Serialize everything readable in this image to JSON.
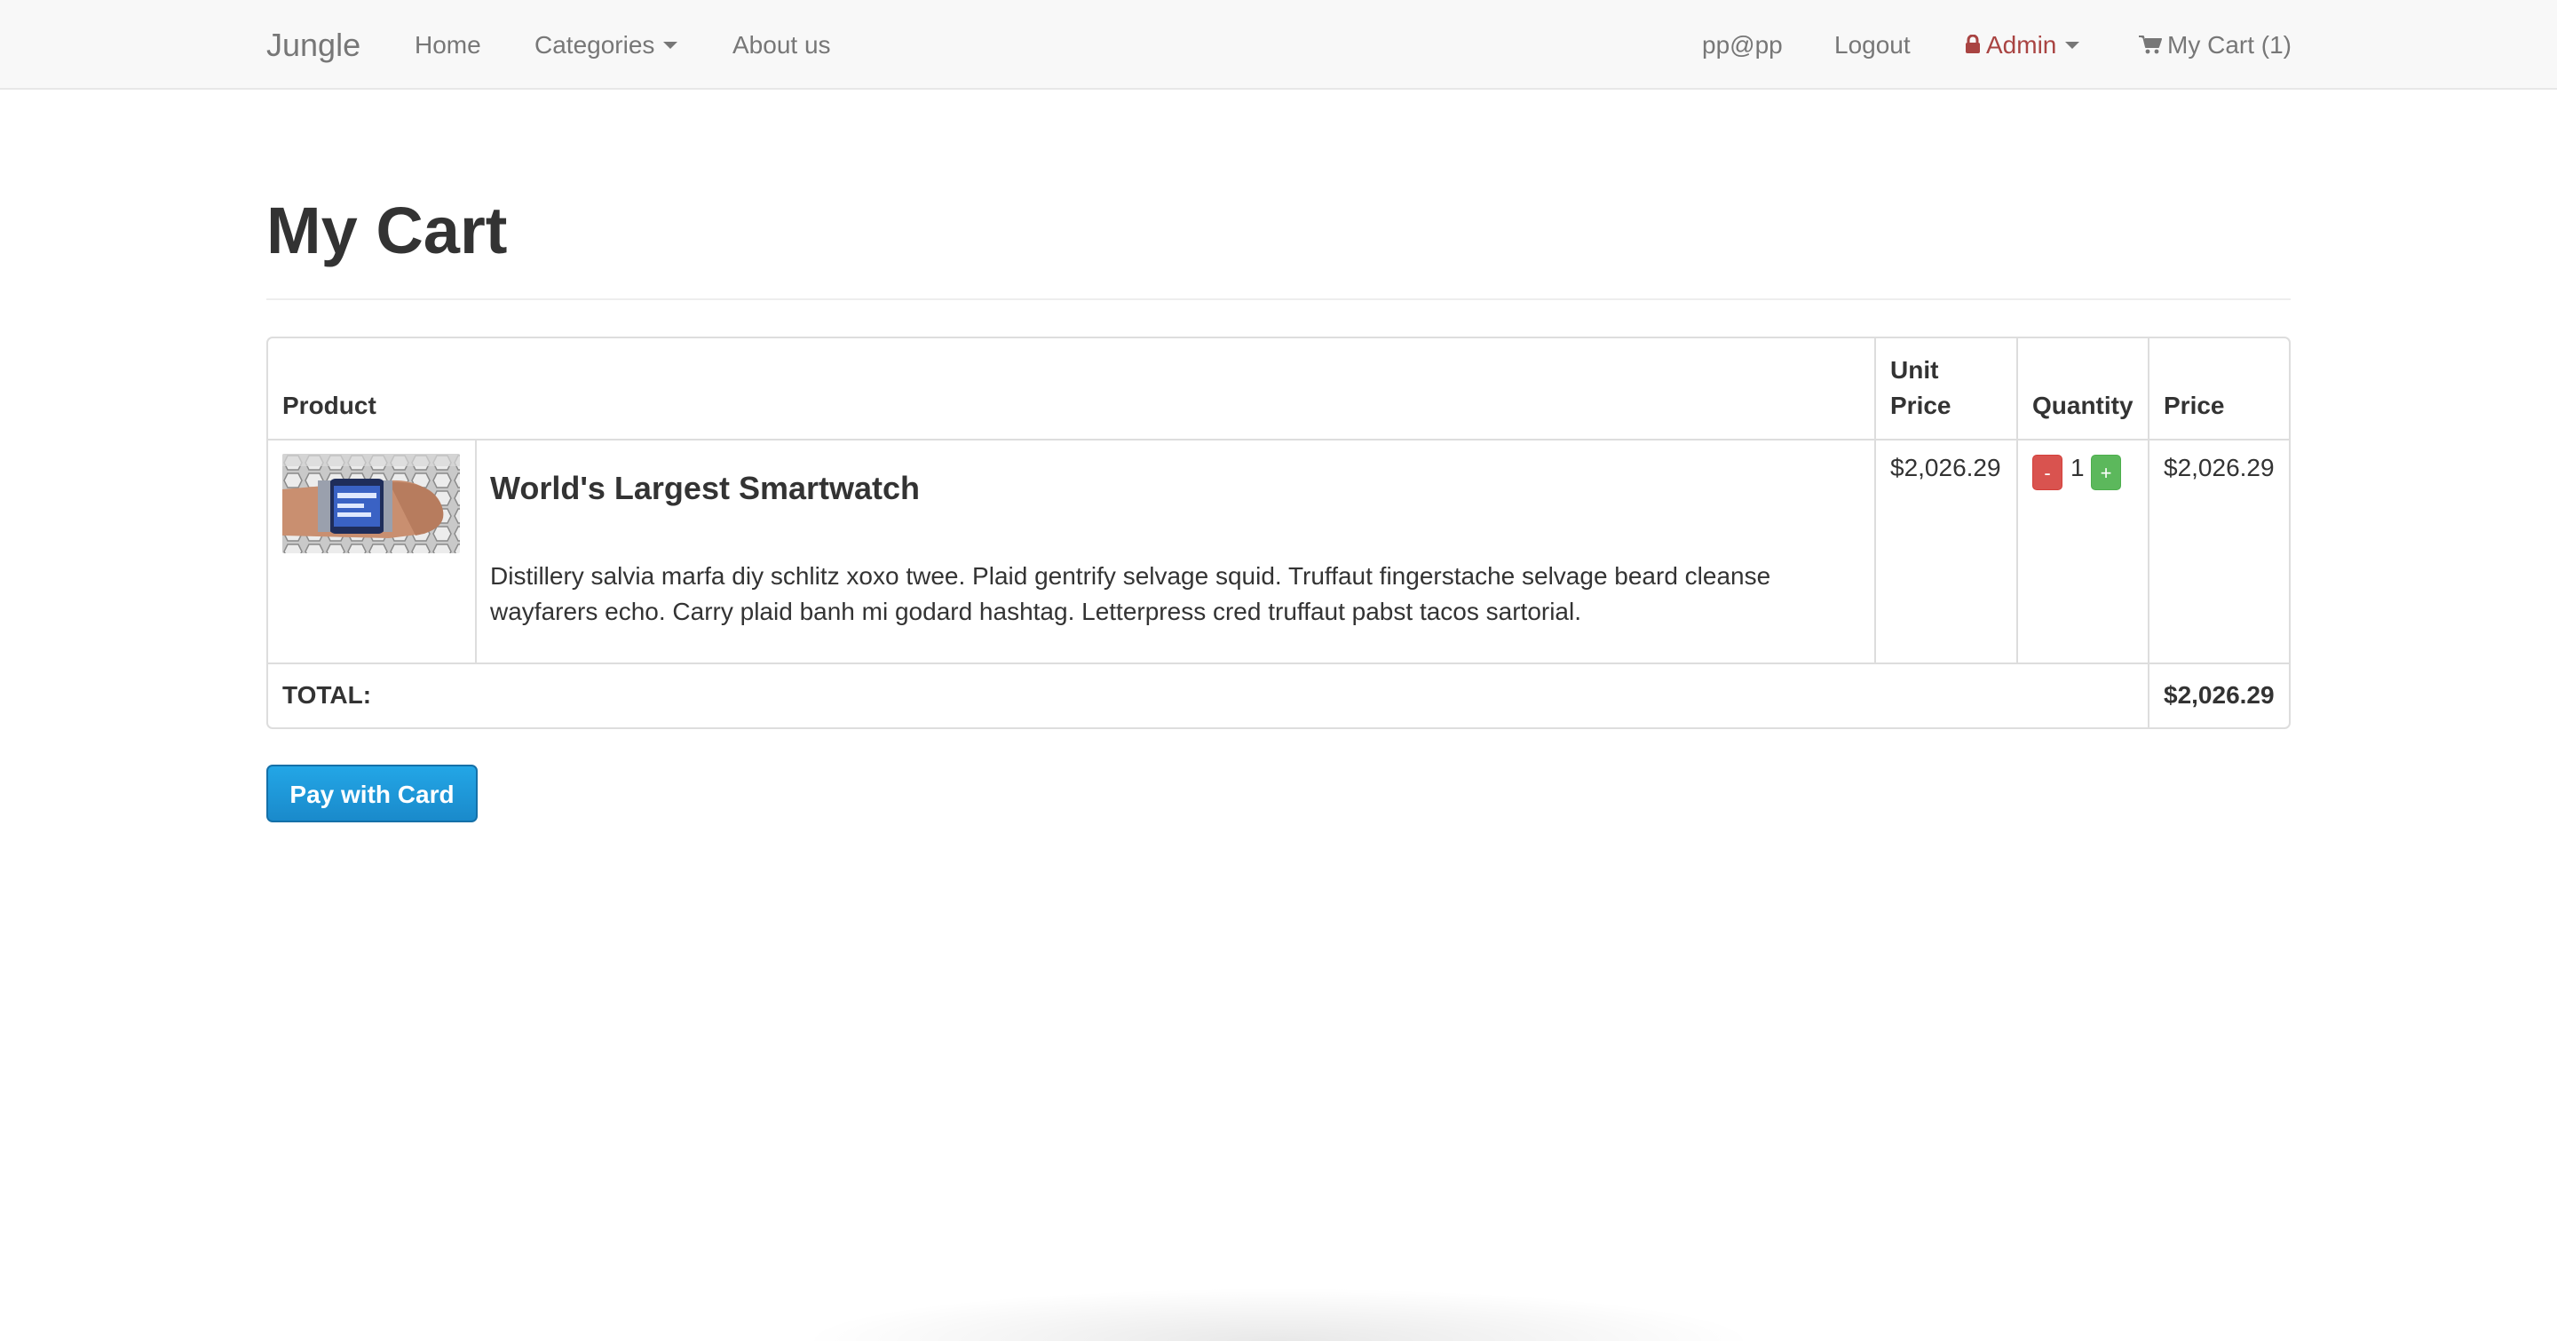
{
  "navbar": {
    "brand": "Jungle",
    "links": [
      "Home",
      "Categories",
      "About us"
    ],
    "user_email": "pp@pp",
    "logout": "Logout",
    "admin": "Admin",
    "cart": "My Cart (1)"
  },
  "page": {
    "title": "My Cart"
  },
  "table": {
    "headers": {
      "product": "Product",
      "unit_price_1": "Unit",
      "unit_price_2": "Price",
      "quantity": "Quantity",
      "price": "Price"
    },
    "items": [
      {
        "name": "World's Largest Smartwatch",
        "description": "Distillery salvia marfa diy schlitz xoxo twee. Plaid gentrify selvage squid. Truffaut fingerstache selvage beard cleanse wayfarers echo. Carry plaid banh mi godard hashtag. Letterpress cred truffaut pabst tacos sartorial.",
        "unit_price": "$2,026.29",
        "quantity": "1",
        "price": "$2,026.29",
        "minus_label": "-",
        "plus_label": "+"
      }
    ],
    "total_label": "TOTAL:",
    "total_value": "$2,026.29"
  },
  "actions": {
    "pay_label": "Pay with Card"
  },
  "colors": {
    "admin": "#a94442",
    "minus": "#d9534f",
    "plus": "#5cb85c",
    "pay": "#1a8acb"
  },
  "icons": {
    "admin": "lock-icon",
    "cart": "shopping-cart-icon"
  }
}
